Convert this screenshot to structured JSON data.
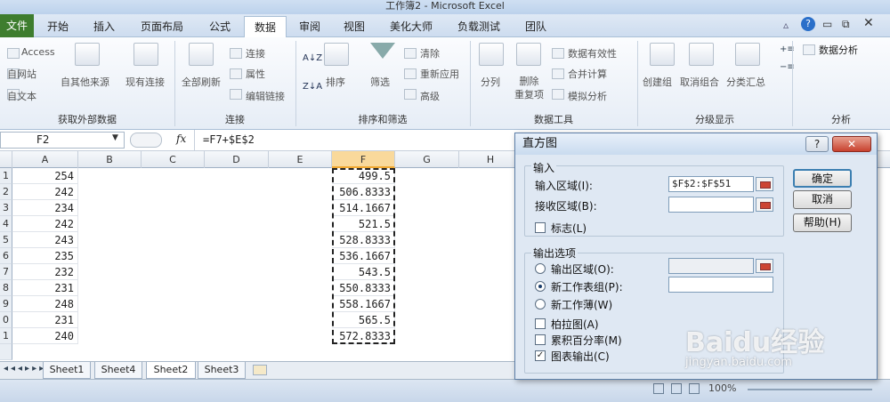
{
  "window": {
    "title": "工作簿2 - Microsoft Excel"
  },
  "tabs": [
    "文件",
    "开始",
    "插入",
    "页面布局",
    "公式",
    "数据",
    "审阅",
    "视图",
    "美化大师",
    "负载测试",
    "团队"
  ],
  "ribbon": {
    "external": {
      "access": "Access",
      "web": "自网站",
      "text": "自文本",
      "other": "自其他来源",
      "existing": "现有连接",
      "group": "获取外部数据"
    },
    "connections": {
      "refresh": "全部刷新",
      "connect": "连接",
      "props": "属性",
      "edit": "编辑链接",
      "group": "连接"
    },
    "sort": {
      "sort": "排序",
      "filter": "筛选",
      "clear": "清除",
      "reapply": "重新应用",
      "advanced": "高级",
      "group": "排序和筛选"
    },
    "tools": {
      "split": "分列",
      "dedupe": "删除\n重复项",
      "validation": "数据有效性",
      "consolidate": "合并计算",
      "whatif": "模拟分析",
      "group": "数据工具"
    },
    "outline": {
      "group_btn": "创建组",
      "ungroup": "取消组合",
      "subtotal": "分类汇总",
      "group": "分级显示"
    },
    "analysis": {
      "btn": "数据分析",
      "group": "分析"
    }
  },
  "formula": {
    "namebox": "F2",
    "fx": "fx",
    "content": "=F7+$E$2"
  },
  "columns": [
    "A",
    "B",
    "C",
    "D",
    "E",
    "F",
    "G",
    "H"
  ],
  "rows": [
    {
      "n": "1",
      "a": "254",
      "f": "499.5"
    },
    {
      "n": "2",
      "a": "242",
      "f": "506.8333"
    },
    {
      "n": "3",
      "a": "234",
      "f": "514.1667"
    },
    {
      "n": "4",
      "a": "242",
      "f": "521.5"
    },
    {
      "n": "5",
      "a": "243",
      "f": "528.8333"
    },
    {
      "n": "6",
      "a": "235",
      "f": "536.1667"
    },
    {
      "n": "7",
      "a": "232",
      "f": "543.5"
    },
    {
      "n": "8",
      "a": "231",
      "f": "550.8333"
    },
    {
      "n": "9",
      "a": "248",
      "f": "558.1667"
    },
    {
      "n": "0",
      "a": "231",
      "f": "565.5"
    },
    {
      "n": "1",
      "a": "240",
      "f": "572.8333"
    }
  ],
  "sheets": [
    "Sheet1",
    "Sheet4",
    "Sheet2",
    "Sheet3"
  ],
  "status": {
    "zoom": "100%"
  },
  "dialog": {
    "title": "直方图",
    "input_section": "输入",
    "input_range_label": "输入区域(I):",
    "input_range_value": "$F$2:$F$51",
    "bin_range_label": "接收区域(B):",
    "bin_range_value": "",
    "labels_label": "标志(L)",
    "output_section": "输出选项",
    "output_range_label": "输出区域(O):",
    "new_sheet_label": "新工作表组(P):",
    "new_book_label": "新工作薄(W)",
    "pareto_label": "柏拉图(A)",
    "cumulative_label": "累积百分率(M)",
    "chart_label": "图表输出(C)",
    "ok": "确定",
    "cancel": "取消",
    "help": "帮助(H)",
    "help_btn": "?",
    "close_btn": "✕"
  },
  "watermark": {
    "brand": "Baidu经验",
    "url": "jingyan.baidu.com"
  }
}
